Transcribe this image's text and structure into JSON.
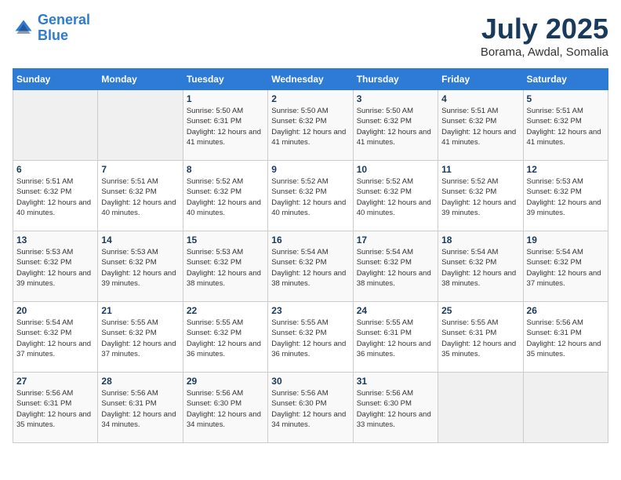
{
  "header": {
    "logo_line1": "General",
    "logo_line2": "Blue",
    "month": "July 2025",
    "location": "Borama, Awdal, Somalia"
  },
  "weekdays": [
    "Sunday",
    "Monday",
    "Tuesday",
    "Wednesday",
    "Thursday",
    "Friday",
    "Saturday"
  ],
  "weeks": [
    [
      {
        "day": "",
        "empty": true
      },
      {
        "day": "",
        "empty": true
      },
      {
        "day": "1",
        "sunrise": "Sunrise: 5:50 AM",
        "sunset": "Sunset: 6:31 PM",
        "daylight": "Daylight: 12 hours and 41 minutes."
      },
      {
        "day": "2",
        "sunrise": "Sunrise: 5:50 AM",
        "sunset": "Sunset: 6:32 PM",
        "daylight": "Daylight: 12 hours and 41 minutes."
      },
      {
        "day": "3",
        "sunrise": "Sunrise: 5:50 AM",
        "sunset": "Sunset: 6:32 PM",
        "daylight": "Daylight: 12 hours and 41 minutes."
      },
      {
        "day": "4",
        "sunrise": "Sunrise: 5:51 AM",
        "sunset": "Sunset: 6:32 PM",
        "daylight": "Daylight: 12 hours and 41 minutes."
      },
      {
        "day": "5",
        "sunrise": "Sunrise: 5:51 AM",
        "sunset": "Sunset: 6:32 PM",
        "daylight": "Daylight: 12 hours and 41 minutes."
      }
    ],
    [
      {
        "day": "6",
        "sunrise": "Sunrise: 5:51 AM",
        "sunset": "Sunset: 6:32 PM",
        "daylight": "Daylight: 12 hours and 40 minutes."
      },
      {
        "day": "7",
        "sunrise": "Sunrise: 5:51 AM",
        "sunset": "Sunset: 6:32 PM",
        "daylight": "Daylight: 12 hours and 40 minutes."
      },
      {
        "day": "8",
        "sunrise": "Sunrise: 5:52 AM",
        "sunset": "Sunset: 6:32 PM",
        "daylight": "Daylight: 12 hours and 40 minutes."
      },
      {
        "day": "9",
        "sunrise": "Sunrise: 5:52 AM",
        "sunset": "Sunset: 6:32 PM",
        "daylight": "Daylight: 12 hours and 40 minutes."
      },
      {
        "day": "10",
        "sunrise": "Sunrise: 5:52 AM",
        "sunset": "Sunset: 6:32 PM",
        "daylight": "Daylight: 12 hours and 40 minutes."
      },
      {
        "day": "11",
        "sunrise": "Sunrise: 5:52 AM",
        "sunset": "Sunset: 6:32 PM",
        "daylight": "Daylight: 12 hours and 39 minutes."
      },
      {
        "day": "12",
        "sunrise": "Sunrise: 5:53 AM",
        "sunset": "Sunset: 6:32 PM",
        "daylight": "Daylight: 12 hours and 39 minutes."
      }
    ],
    [
      {
        "day": "13",
        "sunrise": "Sunrise: 5:53 AM",
        "sunset": "Sunset: 6:32 PM",
        "daylight": "Daylight: 12 hours and 39 minutes."
      },
      {
        "day": "14",
        "sunrise": "Sunrise: 5:53 AM",
        "sunset": "Sunset: 6:32 PM",
        "daylight": "Daylight: 12 hours and 39 minutes."
      },
      {
        "day": "15",
        "sunrise": "Sunrise: 5:53 AM",
        "sunset": "Sunset: 6:32 PM",
        "daylight": "Daylight: 12 hours and 38 minutes."
      },
      {
        "day": "16",
        "sunrise": "Sunrise: 5:54 AM",
        "sunset": "Sunset: 6:32 PM",
        "daylight": "Daylight: 12 hours and 38 minutes."
      },
      {
        "day": "17",
        "sunrise": "Sunrise: 5:54 AM",
        "sunset": "Sunset: 6:32 PM",
        "daylight": "Daylight: 12 hours and 38 minutes."
      },
      {
        "day": "18",
        "sunrise": "Sunrise: 5:54 AM",
        "sunset": "Sunset: 6:32 PM",
        "daylight": "Daylight: 12 hours and 38 minutes."
      },
      {
        "day": "19",
        "sunrise": "Sunrise: 5:54 AM",
        "sunset": "Sunset: 6:32 PM",
        "daylight": "Daylight: 12 hours and 37 minutes."
      }
    ],
    [
      {
        "day": "20",
        "sunrise": "Sunrise: 5:54 AM",
        "sunset": "Sunset: 6:32 PM",
        "daylight": "Daylight: 12 hours and 37 minutes."
      },
      {
        "day": "21",
        "sunrise": "Sunrise: 5:55 AM",
        "sunset": "Sunset: 6:32 PM",
        "daylight": "Daylight: 12 hours and 37 minutes."
      },
      {
        "day": "22",
        "sunrise": "Sunrise: 5:55 AM",
        "sunset": "Sunset: 6:32 PM",
        "daylight": "Daylight: 12 hours and 36 minutes."
      },
      {
        "day": "23",
        "sunrise": "Sunrise: 5:55 AM",
        "sunset": "Sunset: 6:32 PM",
        "daylight": "Daylight: 12 hours and 36 minutes."
      },
      {
        "day": "24",
        "sunrise": "Sunrise: 5:55 AM",
        "sunset": "Sunset: 6:31 PM",
        "daylight": "Daylight: 12 hours and 36 minutes."
      },
      {
        "day": "25",
        "sunrise": "Sunrise: 5:55 AM",
        "sunset": "Sunset: 6:31 PM",
        "daylight": "Daylight: 12 hours and 35 minutes."
      },
      {
        "day": "26",
        "sunrise": "Sunrise: 5:56 AM",
        "sunset": "Sunset: 6:31 PM",
        "daylight": "Daylight: 12 hours and 35 minutes."
      }
    ],
    [
      {
        "day": "27",
        "sunrise": "Sunrise: 5:56 AM",
        "sunset": "Sunset: 6:31 PM",
        "daylight": "Daylight: 12 hours and 35 minutes."
      },
      {
        "day": "28",
        "sunrise": "Sunrise: 5:56 AM",
        "sunset": "Sunset: 6:31 PM",
        "daylight": "Daylight: 12 hours and 34 minutes."
      },
      {
        "day": "29",
        "sunrise": "Sunrise: 5:56 AM",
        "sunset": "Sunset: 6:30 PM",
        "daylight": "Daylight: 12 hours and 34 minutes."
      },
      {
        "day": "30",
        "sunrise": "Sunrise: 5:56 AM",
        "sunset": "Sunset: 6:30 PM",
        "daylight": "Daylight: 12 hours and 34 minutes."
      },
      {
        "day": "31",
        "sunrise": "Sunrise: 5:56 AM",
        "sunset": "Sunset: 6:30 PM",
        "daylight": "Daylight: 12 hours and 33 minutes."
      },
      {
        "day": "",
        "empty": true
      },
      {
        "day": "",
        "empty": true
      }
    ]
  ]
}
